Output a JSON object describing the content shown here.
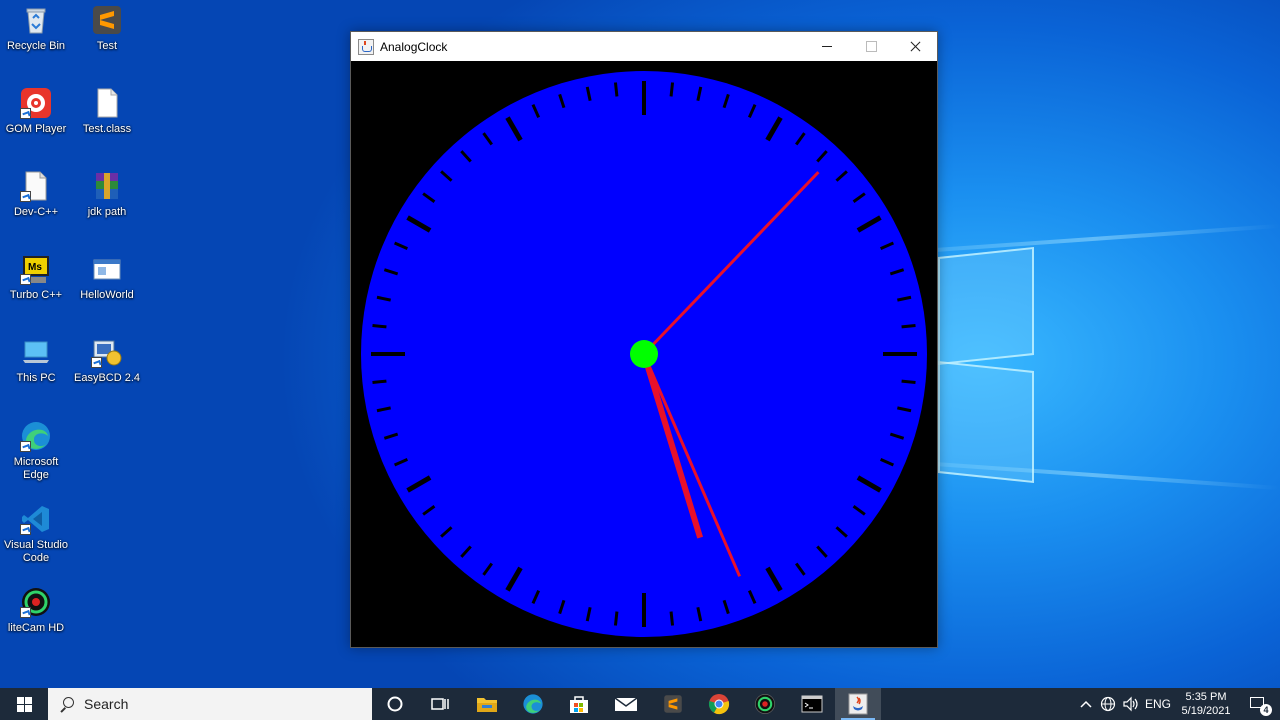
{
  "desktop_icons": [
    {
      "label": "Recycle Bin",
      "icon": "recycle-bin-icon"
    },
    {
      "label": "Test",
      "icon": "sublime-text-icon"
    },
    {
      "label": "GOM Player",
      "icon": "gom-player-icon"
    },
    {
      "label": "Test.class",
      "icon": "file-icon"
    },
    {
      "label": "Dev-C++",
      "icon": "dev-cpp-icon"
    },
    {
      "label": "jdk path",
      "icon": "winrar-archive-icon"
    },
    {
      "label": "Turbo C++",
      "icon": "turbo-cpp-icon"
    },
    {
      "label": "HelloWorld",
      "icon": "window-app-icon"
    },
    {
      "label": "This PC",
      "icon": "this-pc-icon"
    },
    {
      "label": "EasyBCD 2.4",
      "icon": "easybcd-icon"
    },
    {
      "label": "Microsoft Edge",
      "icon": "edge-icon"
    },
    {
      "label": "Visual Studio Code",
      "icon": "vscode-icon"
    },
    {
      "label": "liteCam HD",
      "icon": "litecam-icon"
    }
  ],
  "window": {
    "title": "AnalogClock",
    "icon": "java-app-icon"
  },
  "clock": {
    "face_color": "#0000ff",
    "background_color": "#000000",
    "tick_color": "#000000",
    "hand_color": "#e8102a",
    "center_color": "#00ff00",
    "hour": 5,
    "minute": 26,
    "second": 7.3
  },
  "taskbar": {
    "search_placeholder": "Search",
    "apps": [
      {
        "icon": "cortana-icon"
      },
      {
        "icon": "task-view-icon"
      },
      {
        "icon": "file-explorer-icon"
      },
      {
        "icon": "edge-icon"
      },
      {
        "icon": "microsoft-store-icon"
      },
      {
        "icon": "mail-icon"
      },
      {
        "icon": "sublime-text-icon"
      },
      {
        "icon": "chrome-icon"
      },
      {
        "icon": "litecam-icon"
      },
      {
        "icon": "command-prompt-icon"
      },
      {
        "icon": "java-icon",
        "active": true
      }
    ],
    "tray": {
      "language": "ENG",
      "time": "5:35 PM",
      "date": "5/19/2021",
      "notification_count": "4"
    }
  }
}
